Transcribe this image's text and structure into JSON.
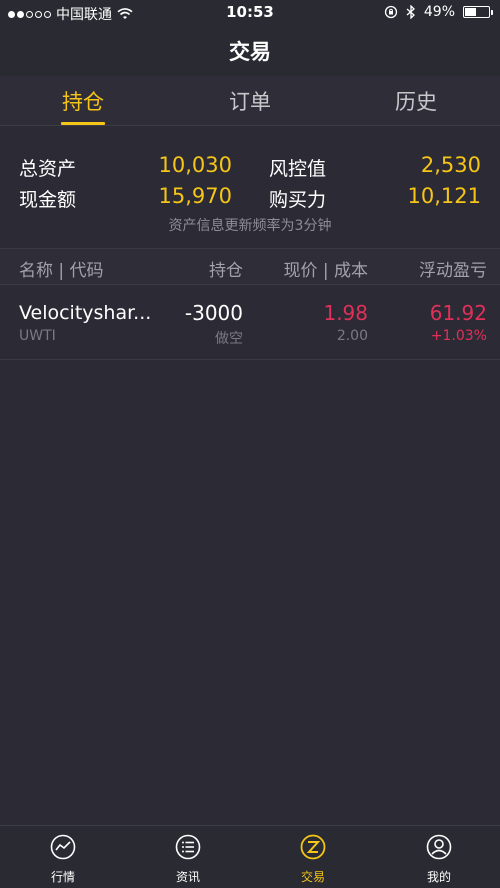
{
  "status_bar": {
    "carrier": "中国联通",
    "time": "10:53",
    "battery": "49%",
    "battery_level": 0.49,
    "signal_bars": 2
  },
  "nav": {
    "title": "交易"
  },
  "tabs": [
    {
      "label": "持仓",
      "active": true
    },
    {
      "label": "订单",
      "active": false
    },
    {
      "label": "历史",
      "active": false
    }
  ],
  "summary": {
    "total_assets_label": "总资产",
    "total_assets_value": "10,030",
    "risk_label": "风控值",
    "risk_value": "2,530",
    "cash_label": "现金额",
    "cash_value": "15,970",
    "buying_power_label": "购买力",
    "buying_power_value": "10,121",
    "note": "资产信息更新频率为3分钟"
  },
  "table": {
    "headers": {
      "name_code": "名称 | 代码",
      "position": "持仓",
      "price_cost": "现价 | 成本",
      "pnl": "浮动盈亏"
    },
    "rows": [
      {
        "name": "Velocityshar...",
        "code": "UWTI",
        "quantity": "-3000",
        "side": "做空",
        "price": "1.98",
        "cost": "2.00",
        "pnl": "61.92",
        "pnl_pct": "+1.03%"
      }
    ]
  },
  "tab_bar": [
    {
      "label": "行情",
      "icon": "chart-line-icon",
      "active": false
    },
    {
      "label": "资讯",
      "icon": "list-icon",
      "active": false
    },
    {
      "label": "交易",
      "icon": "trade-z-icon",
      "active": true
    },
    {
      "label": "我的",
      "icon": "user-icon",
      "active": false
    }
  ],
  "colors": {
    "accent": "#f5c518",
    "background": "#2c2b35",
    "loss_gain_red": "#e0305a"
  }
}
